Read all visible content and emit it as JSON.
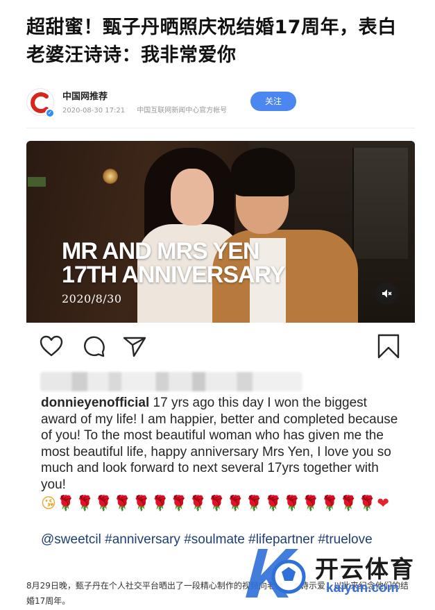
{
  "article": {
    "headline": "超甜蜜！甄子丹晒照庆祝结婚17周年，表白老婆汪诗诗：我非常爱你"
  },
  "author": {
    "name": "中国网推荐",
    "date": "2020-08-30 17:21",
    "source": "中国互联网新闻中心官方帐号",
    "follow_label": "关注",
    "accent_color": "#4c86f0"
  },
  "post": {
    "image": {
      "title_line1": "MR AND MRS YEN",
      "title_line2": "17TH ANNIVERSARY",
      "date": "2020/8/30"
    },
    "icons": [
      "heart-icon",
      "comment-icon",
      "share-icon",
      "bookmark-icon",
      "mute-icon"
    ],
    "caption": {
      "username": "donnieyenofficial",
      "text": " 17 yrs ago this day I won the biggest award of my life! I am happier, better and completed because of you! To the most beautiful woman who has given me the most beautiful life, happy anniversary Mrs Yen, I love you so much and look forward to next several 17yrs together with you!"
    },
    "emojis": {
      "face": "😘",
      "roses": "🌹🌹🌹🌹🌹🌹🌹🌹🌹🌹🌹🌹🌹🌹🌹🌹🌹",
      "heart": "❤"
    },
    "hashtags": "@sweetcil #anniversary #soulmate #lifepartner #truelove"
  },
  "body": {
    "paragraph": "8月29日晚，甄子丹在个人社交平台晒出了一段精心制作的视频向老婆汪诗诗示爱，以此来纪念他们的结婚17周年。"
  },
  "watermark": {
    "brand_cn": "开云体育",
    "brand_en": "kaiyun.com"
  }
}
